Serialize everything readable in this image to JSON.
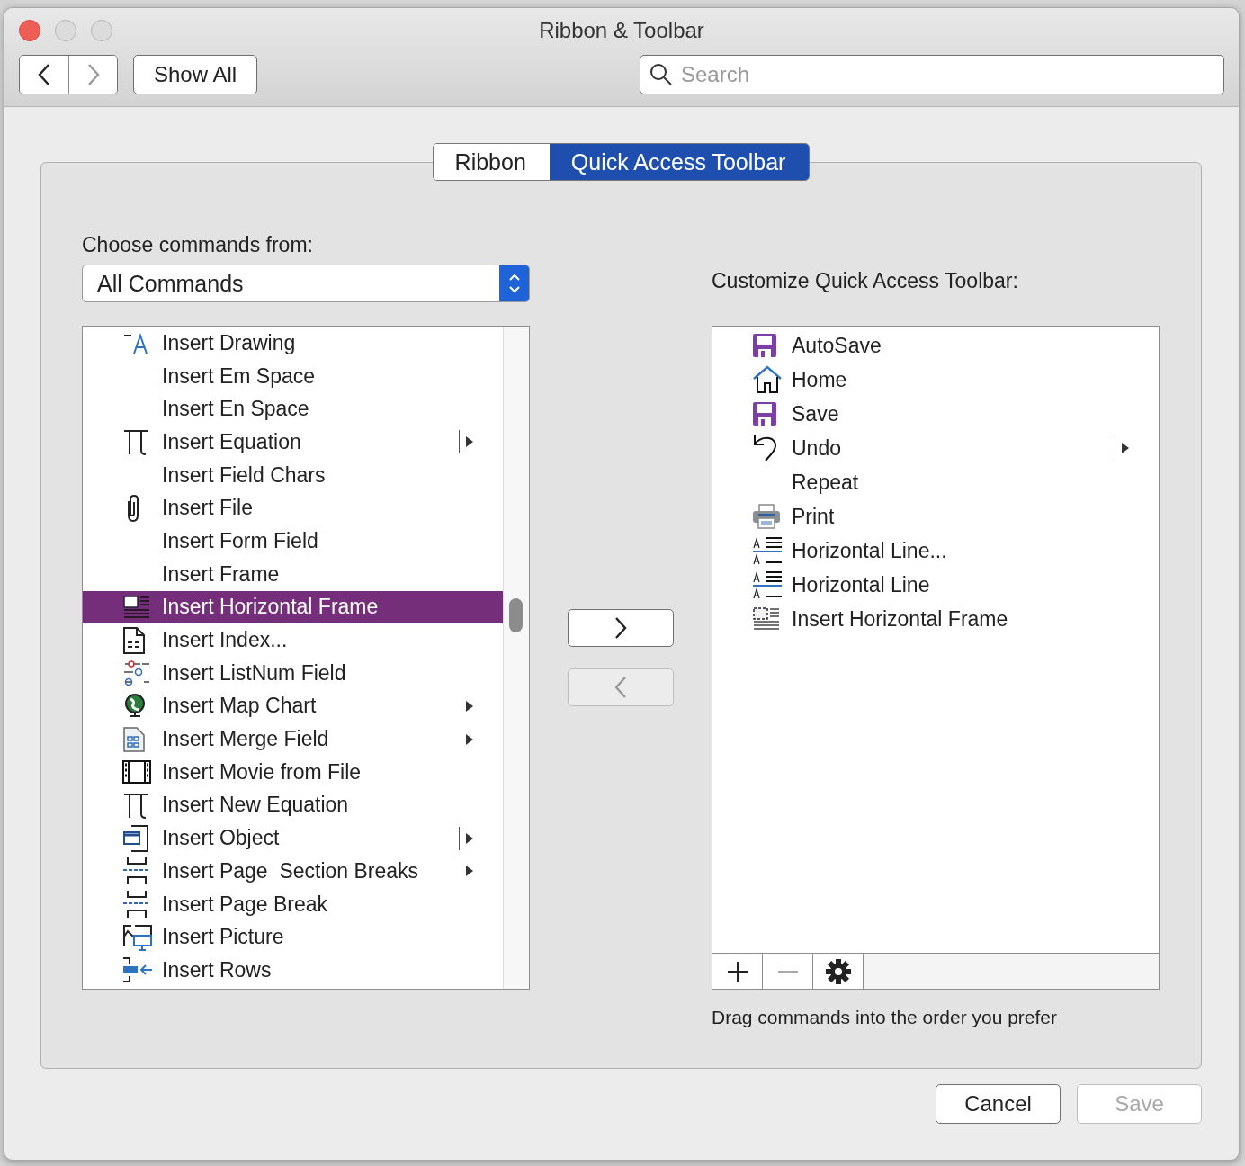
{
  "window": {
    "title": "Ribbon & Toolbar"
  },
  "toolbar": {
    "show_all": "Show All",
    "search": {
      "placeholder": "Search"
    }
  },
  "tabs": [
    {
      "label": "Ribbon",
      "selected": false
    },
    {
      "label": "Quick Access Toolbar",
      "selected": true
    }
  ],
  "commands": {
    "label": "Choose commands from:",
    "dropdown": "All Commands",
    "items": [
      {
        "label": "Insert Drawing",
        "selected": false,
        "submenu": false,
        "split": false
      },
      {
        "label": "Insert Em Space",
        "selected": false,
        "submenu": false,
        "split": false
      },
      {
        "label": "Insert En Space",
        "selected": false,
        "submenu": false,
        "split": false
      },
      {
        "label": "Insert Equation",
        "selected": false,
        "submenu": true,
        "split": true
      },
      {
        "label": "Insert Field Chars",
        "selected": false,
        "submenu": false,
        "split": false
      },
      {
        "label": "Insert File",
        "selected": false,
        "submenu": false,
        "split": false
      },
      {
        "label": "Insert Form Field",
        "selected": false,
        "submenu": false,
        "split": false
      },
      {
        "label": "Insert Frame",
        "selected": false,
        "submenu": false,
        "split": false
      },
      {
        "label": "Insert Horizontal Frame",
        "selected": true,
        "submenu": false,
        "split": false
      },
      {
        "label": "Insert Index...",
        "selected": false,
        "submenu": false,
        "split": false
      },
      {
        "label": "Insert ListNum Field",
        "selected": false,
        "submenu": false,
        "split": false
      },
      {
        "label": "Insert Map Chart",
        "selected": false,
        "submenu": true,
        "split": false
      },
      {
        "label": "Insert Merge Field",
        "selected": false,
        "submenu": true,
        "split": false
      },
      {
        "label": "Insert Movie from File",
        "selected": false,
        "submenu": false,
        "split": false
      },
      {
        "label": "Insert New Equation",
        "selected": false,
        "submenu": false,
        "split": false
      },
      {
        "label": "Insert Object",
        "selected": false,
        "submenu": true,
        "split": true
      },
      {
        "label": "Insert Page  Section Breaks",
        "selected": false,
        "submenu": true,
        "split": false
      },
      {
        "label": "Insert Page Break",
        "selected": false,
        "submenu": false,
        "split": false
      },
      {
        "label": "Insert Picture",
        "selected": false,
        "submenu": false,
        "split": false
      },
      {
        "label": "Insert Rows",
        "selected": false,
        "submenu": false,
        "split": false
      }
    ]
  },
  "transfer": [
    {
      "kind": "add",
      "disabled": false
    },
    {
      "kind": "remove",
      "disabled": true
    }
  ],
  "quick_access": {
    "label": "Customize Quick Access Toolbar:",
    "items": [
      {
        "label": "AutoSave",
        "submenu": false,
        "split": false
      },
      {
        "label": "Home",
        "submenu": false,
        "split": false
      },
      {
        "label": "Save",
        "submenu": false,
        "split": false
      },
      {
        "label": "Undo",
        "submenu": true,
        "split": true
      },
      {
        "label": "Repeat",
        "submenu": false,
        "split": false
      },
      {
        "label": "Print",
        "submenu": false,
        "split": false
      },
      {
        "label": "Horizontal Line...",
        "submenu": false,
        "split": false
      },
      {
        "label": "Horizontal Line",
        "submenu": false,
        "split": false
      },
      {
        "label": "Insert Horizontal Frame",
        "submenu": false,
        "split": false
      }
    ],
    "bar": [
      {
        "kind": "add",
        "disabled": false
      },
      {
        "kind": "remove",
        "disabled": true
      },
      {
        "kind": "settings",
        "disabled": false
      }
    ],
    "hint": "Drag commands into the order you prefer"
  },
  "footer": [
    {
      "label": "Cancel",
      "disabled": false
    },
    {
      "label": "Save",
      "disabled": true
    }
  ]
}
